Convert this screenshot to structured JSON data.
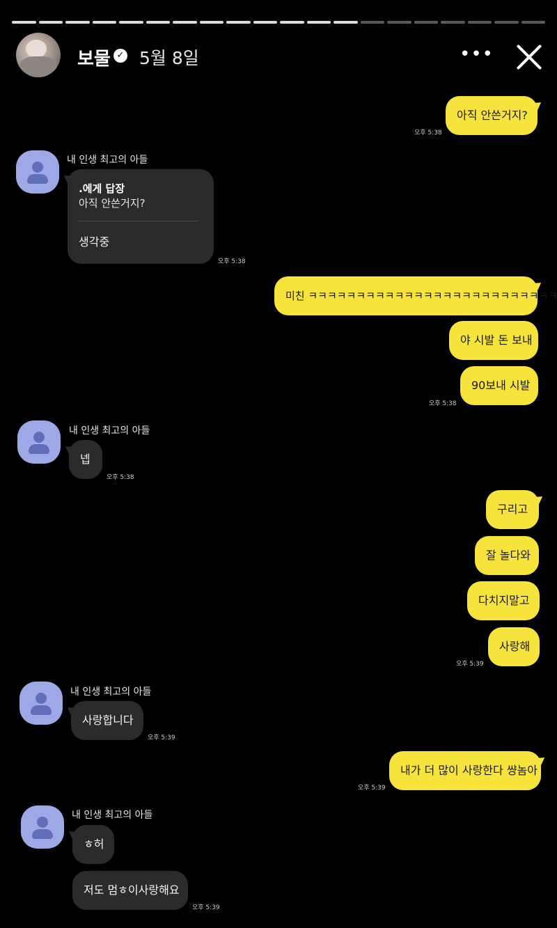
{
  "header": {
    "username": "보물",
    "verified_icon": "verified-check-icon",
    "date": "5월 8일",
    "more_icon": "more-horizontal-icon",
    "close_icon": "close-icon",
    "progress": {
      "segments": 20,
      "completed": 13
    }
  },
  "chat": {
    "partner_name": "내 인생 최고의 아들",
    "reply_card": {
      "title": ".에게 답장",
      "quoted": "아직 안쓴거지?",
      "message": "생각중"
    },
    "messages": {
      "m1": "아직 안쓴거지?",
      "m2": "미친 ㅋㅋㅋㅋㅋㅋㅋㅋㅋㅋㅋㅋㅋㅋㅋㅋㅋㅋㅋㅋㅋㅋㅋㅋㅋㅋㅋ",
      "m3": "야 시발 돈 보내",
      "m4": "90보내 시발",
      "m5": "넵",
      "m6": "구리고",
      "m7": "잘 놀다와",
      "m8": "다치지말고",
      "m9": "사랑해",
      "m10": "사랑합니다",
      "m11": "내가 더 많이 사랑한다 썅놈아",
      "m12": "ㅎ허",
      "m13": "저도 멈ㅎ이사랑해요"
    },
    "times": {
      "t538": "오후 5:38",
      "t539": "오후 5:39"
    }
  },
  "colors": {
    "my_bubble": "#f6e33c",
    "their_bubble": "#2b2b2b",
    "background": "#000000",
    "partner_avatar": "#9ca9e6"
  }
}
